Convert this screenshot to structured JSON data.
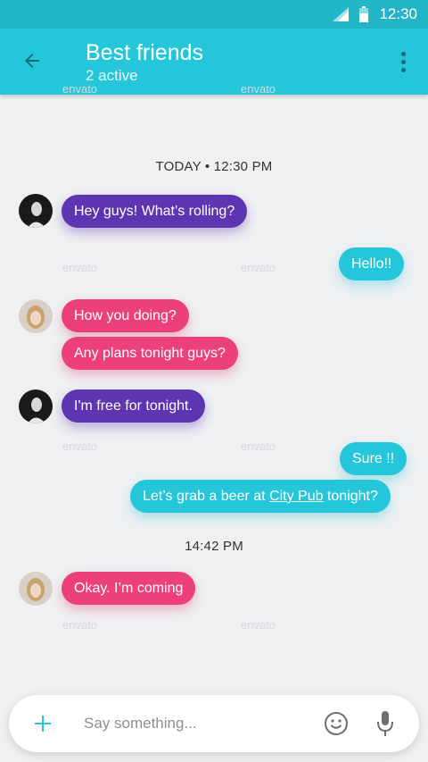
{
  "status_bar": {
    "time": "12:30",
    "icons": [
      "signal-icon",
      "battery-icon"
    ]
  },
  "header": {
    "title": "Best friends",
    "subtitle": "2 active",
    "back_icon": "arrow-left-icon",
    "menu_icon": "more-vert-icon"
  },
  "watermark": "envato",
  "separators": {
    "first": "TODAY • 12:30 PM",
    "second": "14:42 PM"
  },
  "messages": {
    "m1": "Hey guys! What’s rolling?",
    "m2": "Hello!!",
    "m3": "How you doing?",
    "m4": "Any plans tonight guys?",
    "m5": "I'm free for tonight.",
    "m6": "Sure !!",
    "m7_before": "Let’s grab a beer at ",
    "m7_link": "City Pub",
    "m7_after": " tonight?",
    "m8": "Okay. I’m coming"
  },
  "composer": {
    "placeholder": "Say something...",
    "add_icon": "plus-icon",
    "emoji_icon": "smiley-icon",
    "mic_icon": "microphone-icon"
  },
  "colors": {
    "primary": "#26c6da",
    "primary_dark": "#21b5c7",
    "purple": "#5e35b1",
    "pink": "#ec407a",
    "background": "#eef0f2"
  }
}
